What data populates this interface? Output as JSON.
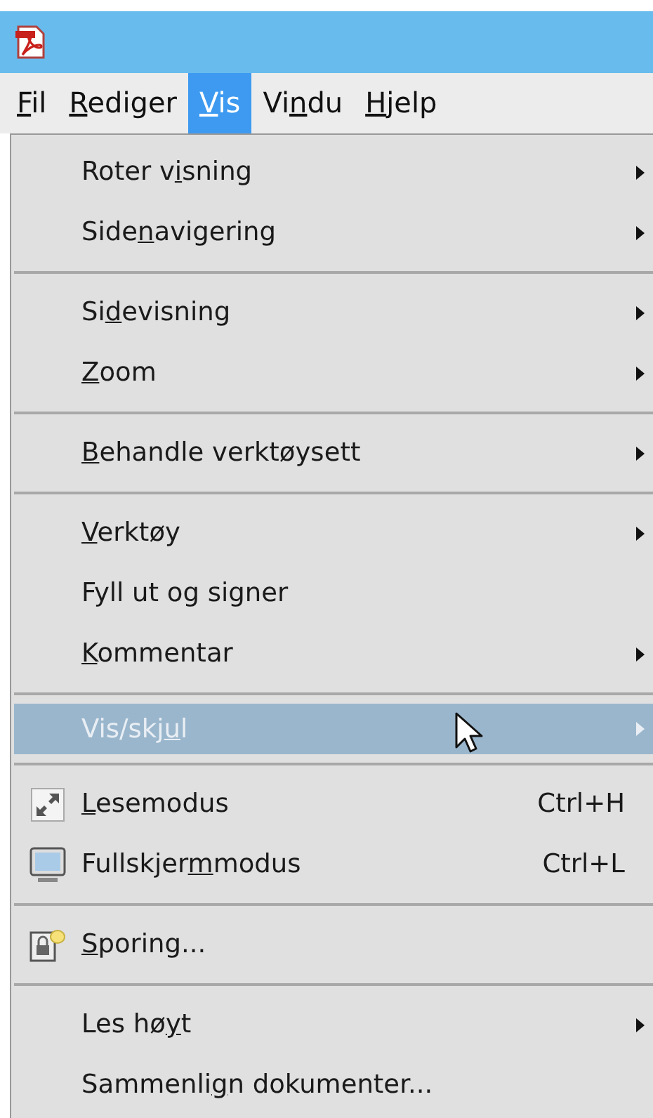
{
  "menubar": [
    {
      "key": "F",
      "post": "il",
      "selected": false
    },
    {
      "key": "R",
      "post": "ediger",
      "selected": false
    },
    {
      "key": "V",
      "post": "is",
      "selected": true
    },
    {
      "pre": "Vi",
      "key": "n",
      "post": "du",
      "selected": false
    },
    {
      "key": "H",
      "post": "jelp",
      "selected": false
    }
  ],
  "menu": {
    "groups": [
      [
        {
          "kind": "plain",
          "pre": "Roter v",
          "key": "i",
          "post": "sning",
          "submenu": true,
          "selected": false
        },
        {
          "kind": "plain",
          "pre": "Side",
          "key": "n",
          "post": "avigering",
          "submenu": true,
          "selected": false
        }
      ],
      [
        {
          "kind": "plain",
          "pre": "Si",
          "key": "d",
          "post": "evisning",
          "submenu": true,
          "selected": false
        },
        {
          "kind": "plain",
          "key": "Z",
          "post": "oom",
          "submenu": true,
          "selected": false
        }
      ],
      [
        {
          "kind": "plain",
          "key": "B",
          "post": "ehandle verktøysett",
          "submenu": true,
          "selected": false
        }
      ],
      [
        {
          "kind": "plain",
          "key": "V",
          "post": "erktøy",
          "submenu": true,
          "selected": false
        },
        {
          "kind": "plain",
          "pre": "Fyll ut og signer",
          "submenu": false,
          "selected": false
        },
        {
          "kind": "plain",
          "key": "K",
          "post": "ommentar",
          "submenu": true,
          "selected": false
        }
      ],
      [
        {
          "kind": "plain",
          "pre": "Vis/skj",
          "key": "u",
          "post": "l",
          "submenu": true,
          "selected": true
        }
      ],
      [
        {
          "kind": "expand",
          "key": "L",
          "post": "esemodus",
          "shortcut": "Ctrl+H",
          "submenu": false,
          "selected": false
        },
        {
          "kind": "monitor",
          "pre": "Fullskjer",
          "key": "m",
          "post": "modus",
          "shortcut": "Ctrl+L",
          "submenu": false,
          "selected": false
        }
      ],
      [
        {
          "kind": "tracker",
          "key": "S",
          "post": "poring...",
          "submenu": false,
          "selected": false
        }
      ],
      [
        {
          "kind": "plain",
          "pre": "Les hø",
          "key": "y",
          "post": "t",
          "submenu": true,
          "selected": false
        },
        {
          "kind": "plain",
          "pre": "Sammenli",
          "key": "g",
          "post": "n dokumenter...",
          "submenu": false,
          "selected": false
        }
      ]
    ]
  }
}
